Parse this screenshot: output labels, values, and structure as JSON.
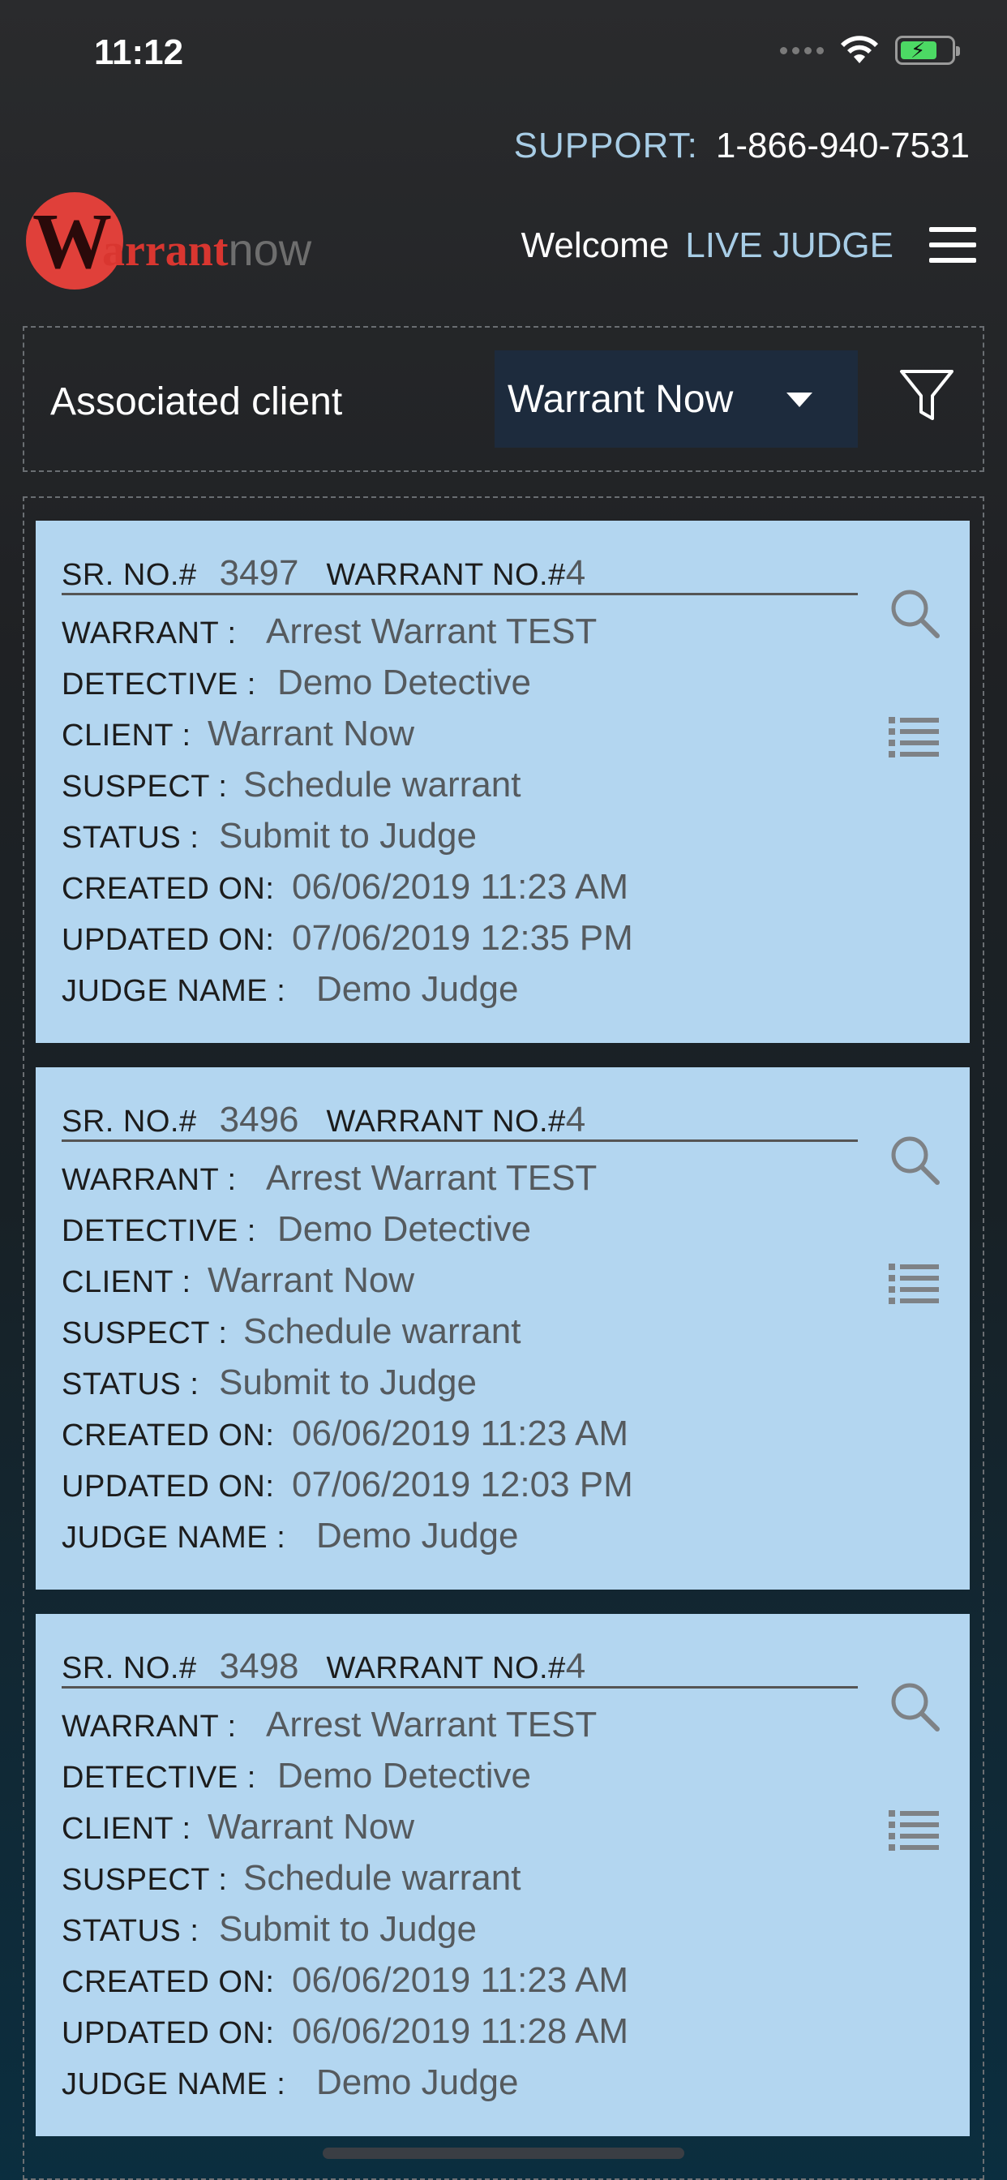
{
  "status_bar": {
    "time": "11:12"
  },
  "header": {
    "support_label": "SUPPORT:",
    "support_phone": "1-866-940-7531",
    "logo_text_w": "W",
    "logo_text_arrant": "arrant",
    "logo_text_now": "now",
    "welcome_label": "Welcome",
    "welcome_user": "LIVE JUDGE"
  },
  "filter": {
    "label": "Associated client",
    "selected_client": "Warrant Now"
  },
  "field_labels": {
    "sr_no": "SR. NO.#",
    "warrant_no": "WARRANT NO.#",
    "warrant": "WARRANT :",
    "detective": "DETECTIVE :",
    "client": "CLIENT :",
    "suspect": "SUSPECT :",
    "status": "STATUS :",
    "created_on": "CREATED ON:",
    "updated_on": "UPDATED ON:",
    "judge_name": "JUDGE NAME :"
  },
  "warrants": [
    {
      "sr_no": "3497",
      "warrant_no": "4",
      "warrant": "Arrest Warrant TEST",
      "detective": "Demo Detective",
      "client": "Warrant Now",
      "suspect": "Schedule warrant",
      "status": "Submit to Judge",
      "created_on": "06/06/2019 11:23 AM",
      "updated_on": "07/06/2019 12:35 PM",
      "judge_name": "Demo Judge"
    },
    {
      "sr_no": "3496",
      "warrant_no": "4",
      "warrant": "Arrest Warrant TEST",
      "detective": "Demo Detective",
      "client": "Warrant Now",
      "suspect": "Schedule warrant",
      "status": "Submit to Judge",
      "created_on": "06/06/2019 11:23 AM",
      "updated_on": "07/06/2019 12:03 PM",
      "judge_name": "Demo Judge"
    },
    {
      "sr_no": "3498",
      "warrant_no": "4",
      "warrant": "Arrest Warrant TEST",
      "detective": "Demo Detective",
      "client": "Warrant Now",
      "suspect": "Schedule warrant",
      "status": "Submit to Judge",
      "created_on": "06/06/2019 11:23 AM",
      "updated_on": "06/06/2019 11:28 AM",
      "judge_name": "Demo Judge"
    }
  ],
  "colors": {
    "card_background": "#b3d6f0",
    "accent_light_blue": "#a8cde6",
    "logo_red": "#e0403a",
    "select_background": "#1d2b3d"
  },
  "icons": {
    "menu": "hamburger-menu-icon",
    "filter": "funnel-filter-icon",
    "card_search": "magnifier-search-icon",
    "card_details": "list-details-icon"
  }
}
